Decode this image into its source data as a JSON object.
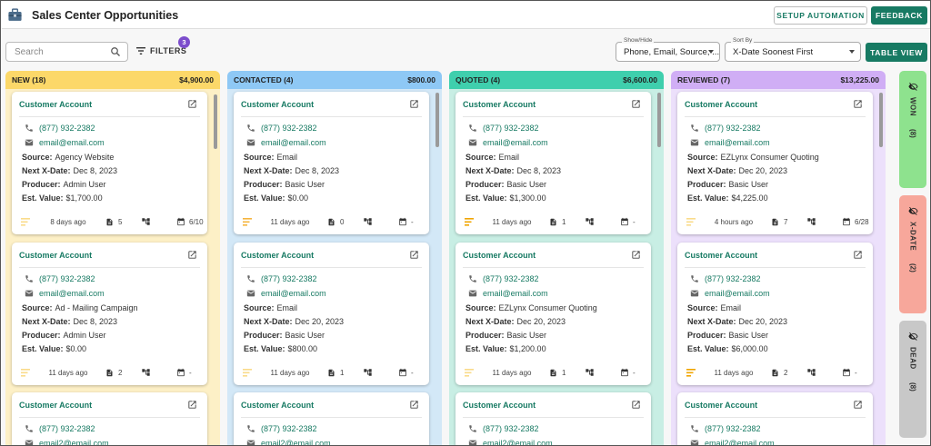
{
  "app": {
    "title": "Sales Center Opportunities"
  },
  "header": {
    "setup_label": "SETUP AUTOMATION",
    "feedback_label": "FEEDBACK"
  },
  "toolbar": {
    "search_placeholder": "Search",
    "filters_label": "FILTERS",
    "filters_count": "3",
    "showhide_label": "Show/Hide",
    "showhide_value": "Phone, Email, Source, ...",
    "sortby_label": "Sort By",
    "sortby_value": "X-Date Soonest First",
    "table_view_label": "TABLE VIEW"
  },
  "columns": [
    {
      "name": "NEW (18)",
      "total": "$4,900.00",
      "head_color": "#fcd869",
      "body_color": "#fdf0c6",
      "cards": [
        {
          "account": "Customer Account",
          "phone": "(877) 932-2382",
          "email": "email@email.com",
          "source_label": "Source:",
          "source": "Agency Website",
          "xdate_label": "Next X-Date:",
          "xdate": "Dec 8, 2023",
          "producer_label": "Producer:",
          "producer": "Admin User",
          "value_label": "Est. Value:",
          "value": "$1,700.00",
          "ago": "8 days ago",
          "docs": "5",
          "cal": "6/10",
          "priority_color": "#fadb8a"
        },
        {
          "account": "Customer Account",
          "phone": "(877) 932-2382",
          "email": "email@email.com",
          "source_label": "Source:",
          "source": "Ad - Mailing Campaign",
          "xdate_label": "Next X-Date:",
          "xdate": "Dec 8, 2023",
          "producer_label": "Producer:",
          "producer": "Admin User",
          "value_label": "Est. Value:",
          "value": "$0.00",
          "ago": "11 days ago",
          "docs": "2",
          "cal": "-",
          "priority_color": "#fadb8a"
        },
        {
          "account": "Customer Account",
          "phone": "(877) 932-2382",
          "email": "email2@email.com"
        }
      ]
    },
    {
      "name": "CONTACTED (4)",
      "total": "$800.00",
      "head_color": "#8ec8f5",
      "body_color": "#d3e8f7",
      "cards": [
        {
          "account": "Customer Account",
          "phone": "(877) 932-2382",
          "email": "email@email.com",
          "source_label": "Source:",
          "source": "Email",
          "xdate_label": "Next X-Date:",
          "xdate": "Dec 8, 2023",
          "producer_label": "Producer:",
          "producer": "Basic User",
          "value_label": "Est. Value:",
          "value": "$0.00",
          "ago": "11 days ago",
          "docs": "0",
          "cal": "-",
          "priority_color": "#f5b43d"
        },
        {
          "account": "Customer Account",
          "phone": "(877) 932-2382",
          "email": "email@email.com",
          "source_label": "Source:",
          "source": "Email",
          "xdate_label": "Next X-Date:",
          "xdate": "Dec 20, 2023",
          "producer_label": "Producer:",
          "producer": "Basic User",
          "value_label": "Est. Value:",
          "value": "$800.00",
          "ago": "11 days ago",
          "docs": "1",
          "cal": "-",
          "priority_color": "#fadb8a"
        },
        {
          "account": "Customer Account",
          "phone": "(877) 932-2382",
          "email": "email2@email.com"
        }
      ]
    },
    {
      "name": "QUOTED (4)",
      "total": "$6,600.00",
      "head_color": "#3fcfad",
      "body_color": "#c8eee4",
      "cards": [
        {
          "account": "Customer Account",
          "phone": "(877) 932-2382",
          "email": "email@email.com",
          "source_label": "Source:",
          "source": "Email",
          "xdate_label": "Next X-Date:",
          "xdate": "Dec 8, 2023",
          "producer_label": "Producer:",
          "producer": "Basic User",
          "value_label": "Est. Value:",
          "value": "$1,300.00",
          "ago": "11 days ago",
          "docs": "1",
          "cal": "-",
          "priority_color": "#f0a500"
        },
        {
          "account": "Customer Account",
          "phone": "(877) 932-2382",
          "email": "email@email.com",
          "source_label": "Source:",
          "source": "EZLynx Consumer Quoting",
          "xdate_label": "Next X-Date:",
          "xdate": "Dec 20, 2023",
          "producer_label": "Producer:",
          "producer": "Basic User",
          "value_label": "Est. Value:",
          "value": "$1,200.00",
          "ago": "11 days ago",
          "docs": "1",
          "cal": "-",
          "priority_color": "#fadb8a"
        },
        {
          "account": "Customer Account",
          "phone": "(877) 932-2382",
          "email": "email2@email.com"
        }
      ]
    },
    {
      "name": "REVIEWED (7)",
      "total": "$13,225.00",
      "head_color": "#d0aef5",
      "body_color": "#ece0fb",
      "cards": [
        {
          "account": "Customer Account",
          "phone": "(877) 932-2382",
          "email": "email@email.com",
          "source_label": "Source:",
          "source": "EZLynx Consumer Quoting",
          "xdate_label": "Next X-Date:",
          "xdate": "Dec 20, 2023",
          "producer_label": "Producer:",
          "producer": "Basic User",
          "value_label": "Est. Value:",
          "value": "$4,225.00",
          "ago": "4 hours ago",
          "docs": "7",
          "cal": "6/28",
          "priority_color": "#fadb8a"
        },
        {
          "account": "Customer Account",
          "phone": "(877) 932-2382",
          "email": "email@email.com",
          "source_label": "Source:",
          "source": "Email",
          "xdate_label": "Next X-Date:",
          "xdate": "Dec 20, 2023",
          "producer_label": "Producer:",
          "producer": "Basic User",
          "value_label": "Est. Value:",
          "value": "$6,000.00",
          "ago": "11 days ago",
          "docs": "2",
          "cal": "-",
          "priority_color": "#f0a500"
        },
        {
          "account": "Customer Account",
          "phone": "(877) 932-2382",
          "email": "email2@email.com"
        }
      ]
    }
  ],
  "side_columns": [
    {
      "name": "WON",
      "count": "(8)",
      "color": "#8ee28e"
    },
    {
      "name": "X-DATE",
      "count": "(2)",
      "color": "#f7a79b"
    },
    {
      "name": "DEAD",
      "count": "(8)",
      "color": "#c8c8c8"
    }
  ]
}
